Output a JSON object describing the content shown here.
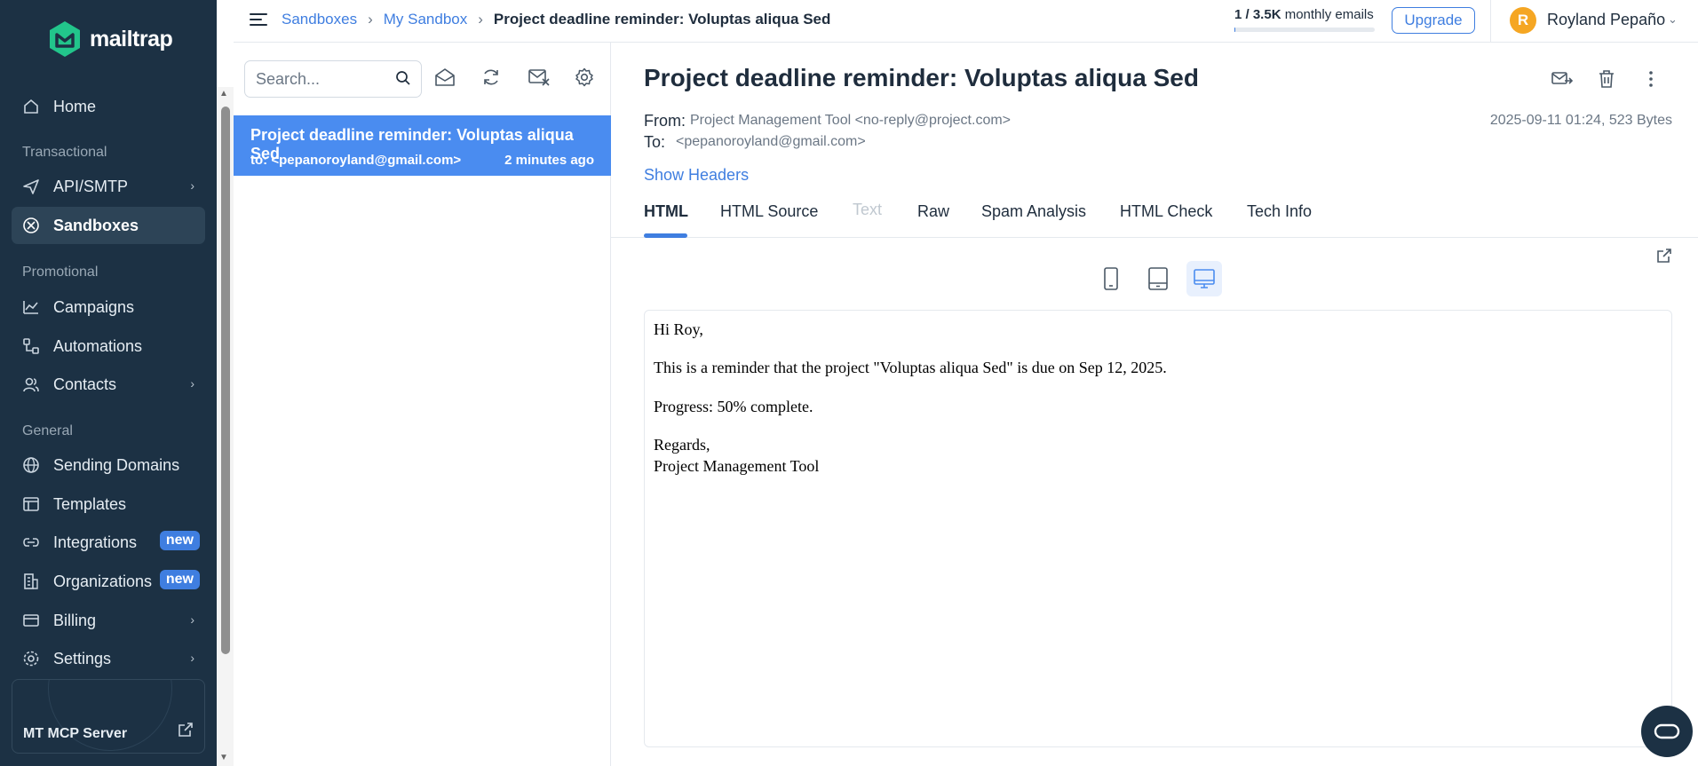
{
  "brand": {
    "logo_text": "mailtrap"
  },
  "sidebar": {
    "home": "Home",
    "section_transactional": "Transactional",
    "api_smtp": "API/SMTP",
    "sandboxes": "Sandboxes",
    "section_promotional": "Promotional",
    "campaigns": "Campaigns",
    "automations": "Automations",
    "contacts": "Contacts",
    "section_general": "General",
    "sending_domains": "Sending Domains",
    "templates": "Templates",
    "integrations": "Integrations",
    "integrations_badge": "new",
    "organizations": "Organizations",
    "organizations_badge": "new",
    "billing": "Billing",
    "settings": "Settings",
    "mcp_server": "MT MCP Server"
  },
  "topbar": {
    "breadcrumb_1": "Sandboxes",
    "breadcrumb_2": "My Sandbox",
    "breadcrumb_current": "Project deadline reminder: Voluptas aliqua Sed",
    "quota_used": "1 / 3.5K",
    "quota_suffix": " monthly emails",
    "upgrade": "Upgrade",
    "avatar_initial": "R",
    "user_name": "Royland Pepaño"
  },
  "list": {
    "search_placeholder": "Search...",
    "items": [
      {
        "subject": "Project deadline reminder: Voluptas aliqua Sed",
        "to": "to: <pepanoroyland@gmail.com>",
        "time": "2 minutes ago"
      }
    ]
  },
  "message": {
    "subject": "Project deadline reminder: Voluptas aliqua Sed",
    "from_label": "From:",
    "from_value": "Project Management Tool <no-reply@project.com>",
    "to_label": "To:",
    "to_value": "<pepanoroyland@gmail.com>",
    "date_size": "2025-09-11 01:24, 523 Bytes",
    "show_headers": "Show Headers",
    "tabs": [
      "HTML",
      "HTML Source",
      "Text",
      "Raw",
      "Spam Analysis",
      "HTML Check",
      "Tech Info"
    ],
    "active_tab": "HTML",
    "body": {
      "greeting": "Hi Roy,",
      "line1": "This is a reminder that the project \"Voluptas aliqua Sed\" is due on Sep 12, 2025.",
      "line2": "Progress: 50% complete.",
      "sign1": "Regards,",
      "sign2": "Project Management Tool"
    }
  },
  "colors": {
    "sidebar_bg": "#1c3144",
    "accent": "#3f7ee0",
    "selected_item": "#4a8cf0",
    "avatar": "#f5a623"
  }
}
